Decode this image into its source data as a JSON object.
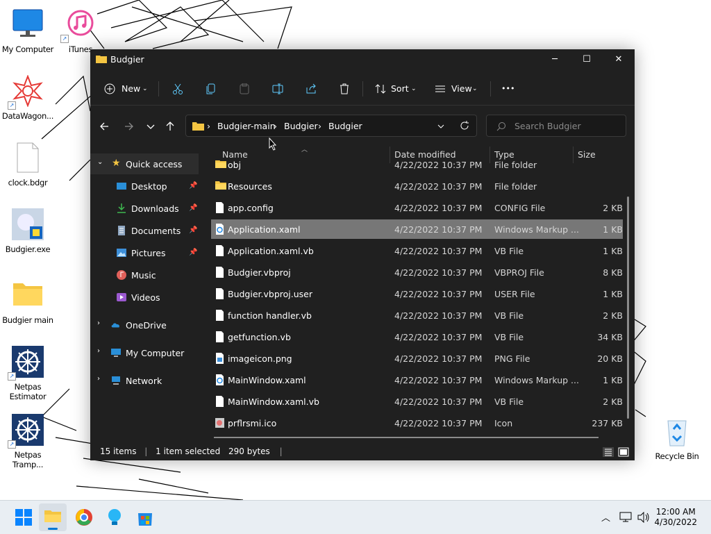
{
  "desktop": {
    "icons": [
      {
        "label": "My Computer",
        "icon": "monitor-icon"
      },
      {
        "label": "iTunes",
        "icon": "itunes-icon"
      },
      {
        "label": "DataWagon...",
        "icon": "datawagon-icon"
      },
      {
        "label": "clock.bdgr",
        "icon": "file-icon"
      },
      {
        "label": "Budgier.exe",
        "icon": "budgier-exe-icon"
      },
      {
        "label": "Budgier main",
        "icon": "folder-icon"
      },
      {
        "label": "Netpas Estimator",
        "icon": "netpas-icon"
      },
      {
        "label": "Netpas Tramp...",
        "icon": "netpas-icon"
      },
      {
        "label": "Recycle Bin",
        "icon": "recycle-bin-icon"
      }
    ]
  },
  "window": {
    "title": "Budgier",
    "controls": {
      "minimize": "─",
      "maximize": "☐",
      "close": "✕"
    }
  },
  "toolbar": {
    "new_label": "New",
    "sort_label": "Sort",
    "view_label": "View",
    "more_label": "•••"
  },
  "address": {
    "crumbs": [
      "Budgier-main",
      "Budgier",
      "Budgier"
    ],
    "separator": "›"
  },
  "search": {
    "placeholder": "Search Budgier"
  },
  "sidebar": {
    "quick_access": "Quick access",
    "items": [
      {
        "label": "Desktop",
        "pinned": true
      },
      {
        "label": "Downloads",
        "pinned": true
      },
      {
        "label": "Documents",
        "pinned": true
      },
      {
        "label": "Pictures",
        "pinned": true
      },
      {
        "label": "Music",
        "pinned": false
      },
      {
        "label": "Videos",
        "pinned": false
      }
    ],
    "onedrive": "OneDrive",
    "my_computer": "My Computer",
    "network": "Network"
  },
  "columns": {
    "name": "Name",
    "date": "Date modified",
    "type": "Type",
    "size": "Size"
  },
  "files": [
    {
      "name": "obj",
      "date": "4/22/2022 10:37 PM",
      "type": "File folder",
      "size": "",
      "kind": "folder"
    },
    {
      "name": "Resources",
      "date": "4/22/2022 10:37 PM",
      "type": "File folder",
      "size": "",
      "kind": "folder"
    },
    {
      "name": "app.config",
      "date": "4/22/2022 10:37 PM",
      "type": "CONFIG File",
      "size": "2 KB",
      "kind": "file"
    },
    {
      "name": "Application.xaml",
      "date": "4/22/2022 10:37 PM",
      "type": "Windows Markup ...",
      "size": "1 KB",
      "kind": "xaml",
      "selected": true
    },
    {
      "name": "Application.xaml.vb",
      "date": "4/22/2022 10:37 PM",
      "type": "VB File",
      "size": "1 KB",
      "kind": "file"
    },
    {
      "name": "Budgier.vbproj",
      "date": "4/22/2022 10:37 PM",
      "type": "VBPROJ File",
      "size": "8 KB",
      "kind": "file"
    },
    {
      "name": "Budgier.vbproj.user",
      "date": "4/22/2022 10:37 PM",
      "type": "USER File",
      "size": "1 KB",
      "kind": "file"
    },
    {
      "name": "function handler.vb",
      "date": "4/22/2022 10:37 PM",
      "type": "VB File",
      "size": "2 KB",
      "kind": "file"
    },
    {
      "name": "getfunction.vb",
      "date": "4/22/2022 10:37 PM",
      "type": "VB File",
      "size": "34 KB",
      "kind": "file"
    },
    {
      "name": "imageicon.png",
      "date": "4/22/2022 10:37 PM",
      "type": "PNG File",
      "size": "20 KB",
      "kind": "png"
    },
    {
      "name": "MainWindow.xaml",
      "date": "4/22/2022 10:37 PM",
      "type": "Windows Markup ...",
      "size": "1 KB",
      "kind": "xaml"
    },
    {
      "name": "MainWindow.xaml.vb",
      "date": "4/22/2022 10:37 PM",
      "type": "VB File",
      "size": "2 KB",
      "kind": "file"
    },
    {
      "name": "prflrsmi.ico",
      "date": "4/22/2022 10:37 PM",
      "type": "Icon",
      "size": "237 KB",
      "kind": "ico"
    }
  ],
  "status": {
    "count": "15 items",
    "selected": "1 item selected",
    "bytes": "290 bytes"
  },
  "taskbar": {
    "time": "12:00 AM",
    "date": "4/30/2022"
  },
  "colors": {
    "window_bg": "#202020",
    "selection": "#777777",
    "accent": "#0078d4",
    "folder": "#f4c542",
    "taskbar": "#e9eef3"
  }
}
